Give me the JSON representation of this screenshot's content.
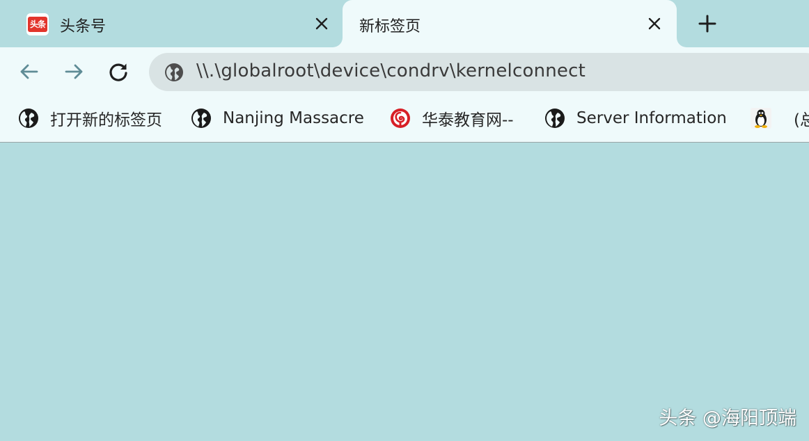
{
  "tabs": [
    {
      "title": "头条号",
      "favicon": "toutiao-logo",
      "favicon_text": "头条",
      "active": false
    },
    {
      "title": "新标签页",
      "active": true
    }
  ],
  "toolbar": {
    "url": "\\\\.\\globalroot\\device\\condrv\\kernelconnect"
  },
  "bookmarks": [
    {
      "label": "打开新的标签页",
      "icon": "globe-icon"
    },
    {
      "label": "Nanjing Massacre",
      "icon": "globe-icon"
    },
    {
      "label": "华泰教育网--",
      "icon": "huatai-logo"
    },
    {
      "label": "Server Information",
      "icon": "globe-icon"
    },
    {
      "label": "(总",
      "icon": "tux-penguin-icon"
    }
  ],
  "watermark": "头条 @海阳顶端",
  "colors": {
    "background": "#b3dcdf",
    "toolbar": "#effafb",
    "omnibox": "#d9e3e4",
    "toutiao_red": "#e2352c"
  }
}
